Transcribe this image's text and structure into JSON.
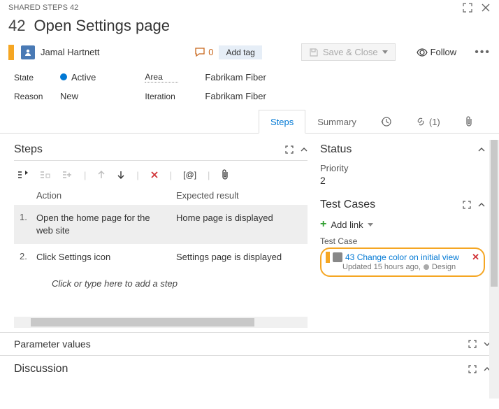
{
  "header": {
    "breadcrumb": "SHARED STEPS 42",
    "id": "42",
    "title": "Open Settings page"
  },
  "author": {
    "name": "Jamal Hartnett"
  },
  "discussion_count": "0",
  "add_tag_label": "Add tag",
  "save_label": "Save & Close",
  "follow_label": "Follow",
  "fields": {
    "state_label": "State",
    "state_value": "Active",
    "reason_label": "Reason",
    "reason_value": "New",
    "area_label": "Area",
    "area_value": "Fabrikam Fiber",
    "iteration_label": "Iteration",
    "iteration_value": "Fabrikam Fiber"
  },
  "tabs": {
    "steps": "Steps",
    "summary": "Summary",
    "links_count": "(1)"
  },
  "steps_section": {
    "title": "Steps",
    "col_action": "Action",
    "col_result": "Expected result",
    "rows": [
      {
        "num": "1.",
        "action": "Open the home page for the web site",
        "result": "Home page is displayed"
      },
      {
        "num": "2.",
        "action": "Click Settings icon",
        "result": "Settings page is displayed"
      }
    ],
    "placeholder": "Click or type here to add a step"
  },
  "status_section": {
    "title": "Status",
    "priority_label": "Priority",
    "priority_value": "2"
  },
  "test_cases": {
    "title": "Test Cases",
    "add_link": "Add link",
    "label": "Test Case",
    "item": {
      "id": "43",
      "name": "Change color on initial view",
      "updated": "Updated 15 hours ago,",
      "state": "Design"
    }
  },
  "param_title": "Parameter values",
  "discussion_title": "Discussion"
}
